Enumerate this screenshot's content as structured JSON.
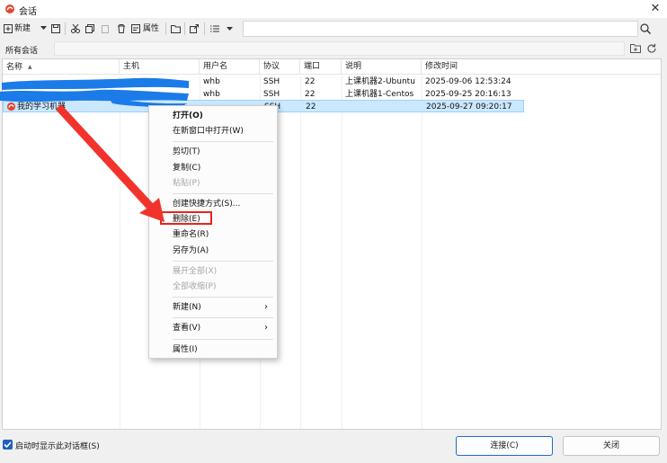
{
  "window": {
    "title": "会话",
    "close_glyph": "✕"
  },
  "toolbar": {
    "new_label": "新建",
    "properties_label": "属性"
  },
  "sessions_bar": {
    "label": "所有会话"
  },
  "columns": [
    "名称",
    "主机",
    "用户名",
    "协议",
    "端口",
    "说明",
    "修改时间"
  ],
  "rows": [
    {
      "name": "",
      "host": "",
      "user": "whb",
      "protocol": "SSH",
      "port": "22",
      "desc": "上课机器2-Ubuntu",
      "modified": "2025-09-06 12:53:24"
    },
    {
      "name": "",
      "host": "",
      "user": "whb",
      "protocol": "SSH",
      "port": "22",
      "desc": "上课机器1-Centos",
      "modified": "2025-09-25 20:16:13"
    },
    {
      "name": "我的学习机器",
      "host": "",
      "user": "",
      "protocol": "SSH",
      "port": "22",
      "desc": "",
      "modified": "2025-09-27 09:20:17"
    }
  ],
  "context_menu": [
    {
      "label": "打开(O)",
      "bold": true
    },
    {
      "label": "在新窗口中打开(W)"
    },
    {
      "label": "剪切(T)"
    },
    {
      "label": "复制(C)"
    },
    {
      "label": "粘贴(P)",
      "disabled": true
    },
    {
      "label": "创建快捷方式(S)..."
    },
    {
      "label": "删除(E)",
      "highlighted": true
    },
    {
      "label": "重命名(R)"
    },
    {
      "label": "另存为(A)"
    },
    {
      "label": "展开全部(X)",
      "disabled": true
    },
    {
      "label": "全部收缩(P)",
      "disabled": true
    },
    {
      "label": "新建(N)",
      "submenu": true
    },
    {
      "label": "查看(V)",
      "submenu": true
    },
    {
      "label": "属性(I)"
    }
  ],
  "submenu_glyph": "›",
  "bottom": {
    "startup_checkbox_label": "启动时显示此对话框(S)",
    "startup_checked": true,
    "connect_label": "连接(C)",
    "close_label": "关闭"
  },
  "colors": {
    "accent": "#1e6ad0",
    "selection": "#cce8ff",
    "annotation_red": "#e8231e"
  }
}
